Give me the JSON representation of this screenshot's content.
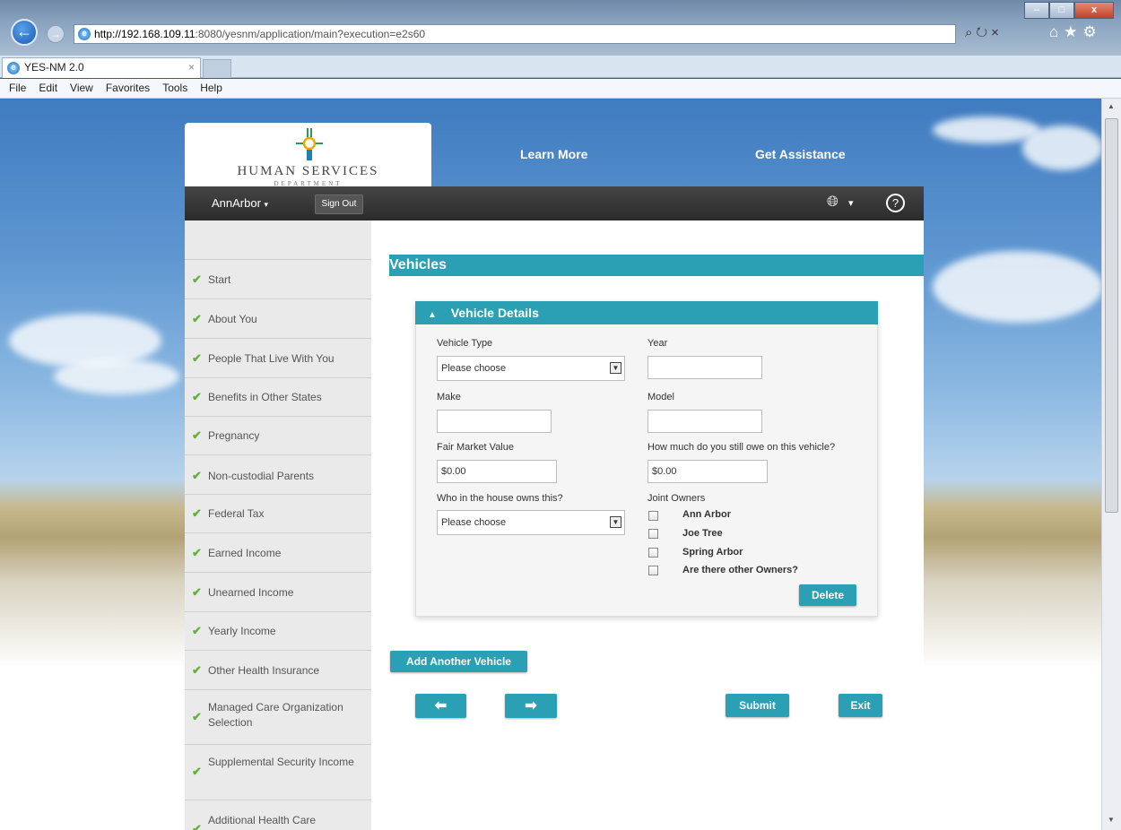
{
  "browser": {
    "url_host": "http://192.168.109.11",
    "url_rest": ":8080/yesnm/application/main?execution=e2s60",
    "tab_title": "YES-NM 2.0",
    "tab_close": "×",
    "menu": [
      "File",
      "Edit",
      "View",
      "Favorites",
      "Tools",
      "Help"
    ],
    "window_controls": {
      "minimize": "–",
      "maximize": "□",
      "close": "x"
    }
  },
  "header": {
    "logo_text": "HUMAN SERVICES",
    "logo_sub": "DEPARTMENT",
    "links": {
      "learn_more": "Learn More",
      "get_assistance": "Get Assistance"
    },
    "user_name": "AnnArbor",
    "sign_out": "Sign Out"
  },
  "sidebar": {
    "items": [
      "Start",
      "About You",
      "People That Live With You",
      "Benefits in Other States",
      "Pregnancy",
      "Non-custodial Parents",
      "Federal Tax",
      "Earned Income",
      "Unearned Income",
      "Yearly Income",
      "Other Health Insurance",
      "Managed Care Organization Selection",
      "Supplemental Security Income",
      "Additional Health Care"
    ]
  },
  "main": {
    "section_title": "Vehicles",
    "panel_title": "Vehicle Details",
    "fields": {
      "vehicle_type_label": "Vehicle Type",
      "vehicle_type_value": "Please choose",
      "year_label": "Year",
      "year_value": "",
      "make_label": "Make",
      "make_value": "",
      "model_label": "Model",
      "model_value": "",
      "fmv_label": "Fair Market Value",
      "fmv_value": "$0.00",
      "owe_label": "How much do you still owe on this vehicle?",
      "owe_value": "$0.00",
      "owner_label": "Who in the house owns this?",
      "owner_value": "Please choose",
      "joint_label": "Joint Owners"
    },
    "joint_owners": [
      "Ann Arbor",
      "Joe Tree",
      "Spring Arbor",
      "Are there other Owners?"
    ],
    "buttons": {
      "delete": "Delete",
      "add_vehicle": "Add Another Vehicle",
      "back": "⬅",
      "next": "➡",
      "submit": "Submit",
      "exit": "Exit"
    }
  }
}
